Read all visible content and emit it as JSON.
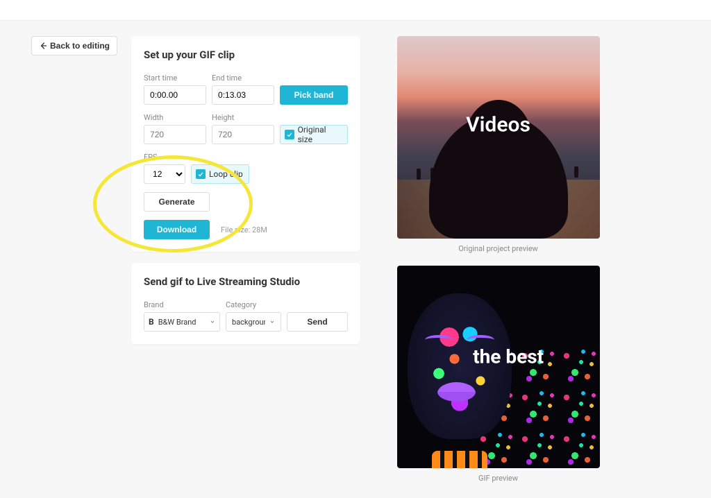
{
  "back_button": "Back to editing",
  "gif_panel": {
    "title": "Set up your GIF clip",
    "start_label": "Start time",
    "start_value": "0:00.00",
    "end_label": "End time",
    "end_value": "0:13.03",
    "pick_band": "Pick band",
    "width_label": "Width",
    "width_value": "720",
    "height_label": "Height",
    "height_value": "720",
    "original_size": "Original size",
    "fps_label": "FPS",
    "fps_value": "12",
    "loop_clip": "Loop clip",
    "generate": "Generate",
    "download": "Download",
    "filesize": "File size: 28M"
  },
  "send_panel": {
    "title": "Send gif to Live Streaming Studio",
    "brand_label": "Brand",
    "brand_value": "B&W Brand",
    "brand_prefix": "B",
    "category_label": "Category",
    "category_value": "background",
    "send": "Send"
  },
  "previews": {
    "original_caption": "Original project preview",
    "original_overlay": "Videos",
    "gif_caption": "GIF preview",
    "gif_overlay": "the best"
  }
}
